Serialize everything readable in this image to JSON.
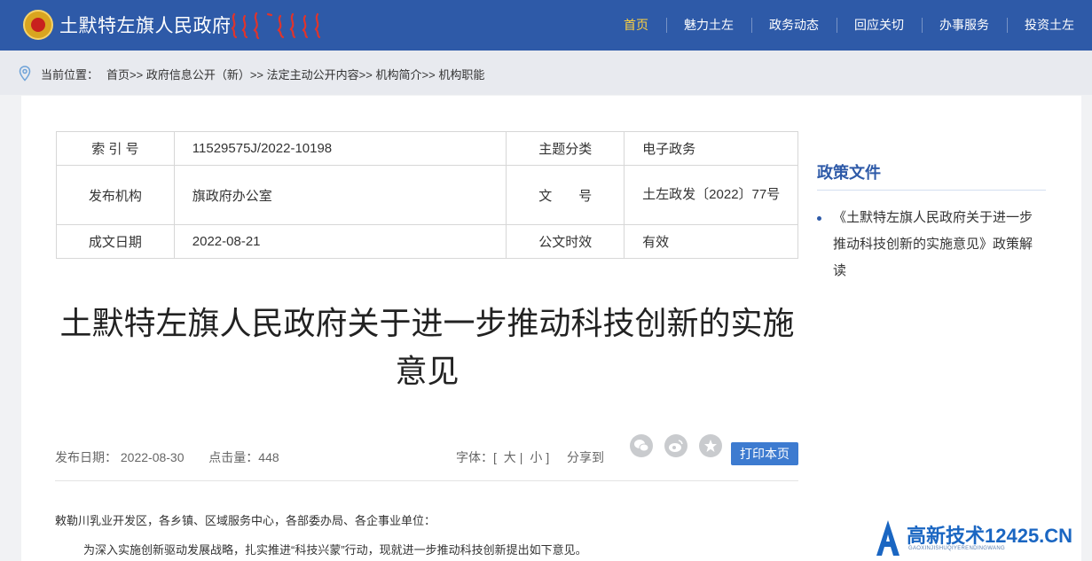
{
  "header": {
    "site_title": "土默特左旗人民政府",
    "nav": [
      {
        "label": "首页"
      },
      {
        "label": "魅力土左"
      },
      {
        "label": "政务动态"
      },
      {
        "label": "回应关切"
      },
      {
        "label": "办事服务"
      },
      {
        "label": "投资土左"
      }
    ],
    "active_color": "#ffd23f",
    "bg_color": "#2e5aa8"
  },
  "breadcrumb": {
    "label": "当前位置：",
    "items": [
      "首页",
      "政府信息公开（新）",
      "法定主动公开内容",
      "机构简介",
      "机构职能"
    ],
    "separator": ">>"
  },
  "meta": {
    "index_label": "索 引 号",
    "index_value": "11529575J/2022-10198",
    "topic_label": "主题分类",
    "topic_value": "电子政务",
    "org_label": "发布机构",
    "org_value": "旗政府办公室",
    "docno_label": "文　　号",
    "docno_value": "土左政发〔2022〕77号",
    "date_label": "成文日期",
    "date_value": "2022-08-21",
    "validity_label": "公文时效",
    "validity_value": "有效"
  },
  "document": {
    "title": "土默特左旗人民政府关于进一步推动科技创新的实施意见",
    "publish_label": "发布日期：",
    "publish_date": "2022-08-30",
    "hits_label": "点击量：",
    "hits": "448",
    "font_label": "字体：",
    "font_large": "大",
    "font_small": "小",
    "share_label": "分享到",
    "print_label": "打印本页",
    "salutation": "敕勒川乳业开发区，各乡镇、区域服务中心，各部委办局、各企事业单位：",
    "intro": "为深入实施创新驱动发展战略，扎实推进“科技兴蒙”行动，现就进一步推动科技创新提出如下意见。"
  },
  "sidebar": {
    "title": "政策文件",
    "items": [
      "《土默特左旗人民政府关于进一步推动科技创新的实施意见》政策解读"
    ]
  },
  "watermark": {
    "text": "高新技术12425.CN",
    "sub": "GAOXINJISHUQIYERENDINGWANG"
  },
  "icons": {
    "location": "location-pin-icon",
    "share": [
      "wechat-icon",
      "weibo-icon",
      "favorite-icon"
    ]
  }
}
